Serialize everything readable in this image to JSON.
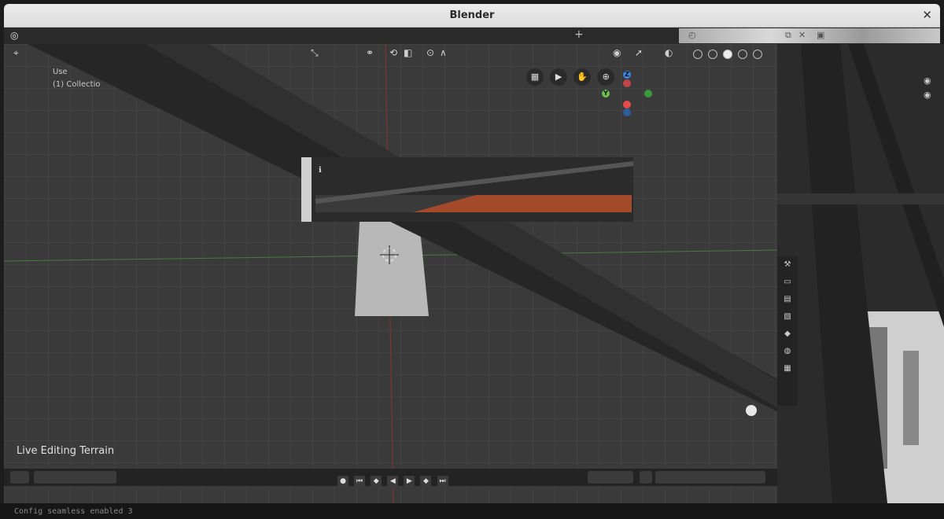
{
  "window": {
    "title": "Blender",
    "close_glyph": "✕"
  },
  "topbar": {
    "logo_icon": "blender-logo-icon",
    "add_workspace": "+"
  },
  "viewport": {
    "overlay_line1": "Use",
    "overlay_line2": "(1) Collectio",
    "status_label": "Live Editing Terrain",
    "toolbar_icons": [
      "transform-icon",
      "link-icon",
      "snap-icon",
      "proportional-icon",
      "visibility-icon",
      "overlay-icon",
      "xray-icon"
    ],
    "gizmo": {
      "z": "Z",
      "y": "Y",
      "x_color": "#e44b4b",
      "y_color": "#6ec04f",
      "z_color": "#3a87e0"
    }
  },
  "bottom": {
    "terminal_text": "Config seamless enabled 3"
  }
}
